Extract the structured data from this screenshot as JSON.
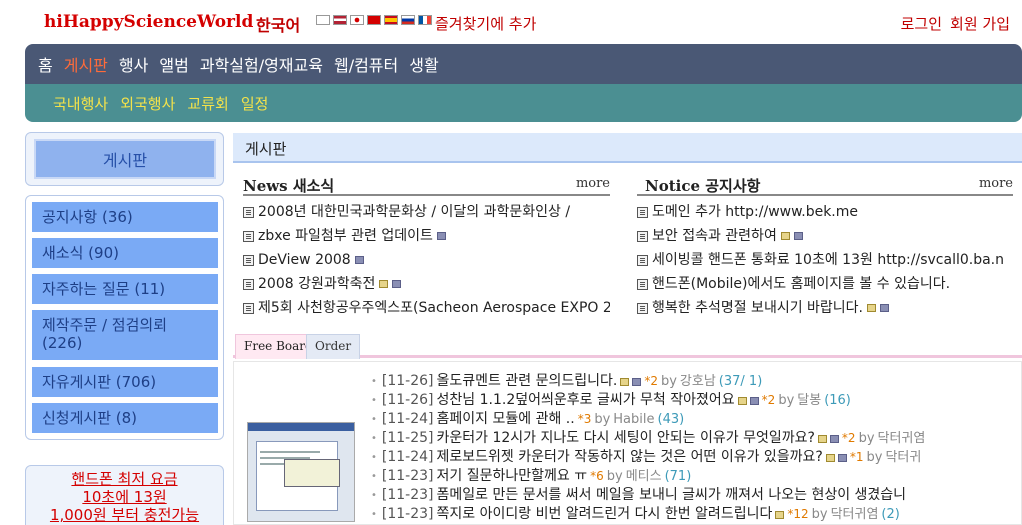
{
  "header": {
    "logo_hi": "hi",
    "logo_mid": "HappyScience",
    "logo_w": "World",
    "language": "한국어",
    "favorite": "즐겨찾기에 추가",
    "login": "로그인",
    "signup": "회원 가입"
  },
  "nav": {
    "main": [
      "홈",
      "게시판",
      "행사",
      "앨범",
      "과학실험/영재교육",
      "웹/컴퓨터",
      "생활"
    ],
    "active_index": 1,
    "sub": [
      "국내행사",
      "외국행사",
      "교류회",
      "일정"
    ]
  },
  "sidebar": {
    "title": "게시판",
    "items": [
      {
        "label": "공지사항 (36)"
      },
      {
        "label": "새소식 (90)"
      },
      {
        "label": "자주하는 질문 (11)"
      },
      {
        "label": "제작주문 / 점검의뢰 (226)"
      },
      {
        "label": "자유게시판 (706)"
      },
      {
        "label": "신청게시판 (8)"
      }
    ],
    "ad": [
      "핸드폰 최저 요금",
      "10초에 13원",
      "1,000원 부터 충전가능"
    ]
  },
  "board": {
    "title": "게시판",
    "news": {
      "title": "News 새소식",
      "more": "more",
      "items": [
        "2008년 대한민국과학문화상 / 이달의 과학문화인상 /",
        "zbxe 파일첨부 관련 업데이트",
        "DeView 2008",
        "2008 강원과학축전",
        "제5회 사천항공우주엑스포(Sacheon Aerospace EXPO 2"
      ]
    },
    "notice": {
      "title": "Notice 공지사항",
      "more": "more",
      "items": [
        "도메인 추가 http://www.bek.me",
        "보안 접속과 관련하여",
        "세이빙콜 핸드폰 통화료 10초에 13원 http://svcall0.ba.n",
        "핸드폰(Mobile)에서도 홈페이지를 볼 수 있습니다.",
        "행복한 추석명절 보내시기 바랍니다."
      ]
    },
    "tabs": [
      "Free Board",
      "Order"
    ],
    "posts": [
      {
        "date": "[11-26]",
        "title": "올도큐멘트 관련 문의드립니다.",
        "comments": "*2",
        "by": "by",
        "author": "강호남",
        "reads": "(37/ 1)"
      },
      {
        "date": "[11-26]",
        "title": "성찬님 1.1.2덮어씌운후로 글씨가 무척 작아졌어요",
        "comments": "*2",
        "by": "by",
        "author": "달봉",
        "reads": "(16)"
      },
      {
        "date": "[11-24]",
        "title": "홈페이지 모듈에 관해 ..",
        "comments": "*3",
        "by": "by",
        "author": "Habile",
        "reads": "(43)"
      },
      {
        "date": "[11-25]",
        "title": "카운터가 12시가 지나도 다시 세팅이 안되는 이유가 무엇일까요?",
        "comments": "*2",
        "by": "by",
        "author": "닥터귀염",
        "reads": ""
      },
      {
        "date": "[11-24]",
        "title": "제로보드위젯 카운터가 작동하지 않는 것은 어떤 이유가 있을까요?",
        "comments": "*1",
        "by": "by",
        "author": "닥터귀",
        "reads": ""
      },
      {
        "date": "[11-23]",
        "title": "저기 질문하나만할께요 ㅠ",
        "comments": "*6",
        "by": "by",
        "author": "메티스",
        "reads": "(71)"
      },
      {
        "date": "[11-23]",
        "title": "폼메일로 만든 문서를 써서 메일을 보내니 글씨가 깨져서 나오는 현상이 생겼습니",
        "comments": "",
        "by": "",
        "author": "",
        "reads": ""
      },
      {
        "date": "[11-23]",
        "title": "쪽지로 아이디랑 비번 알려드린거 다시 한번 알려드립니다",
        "comments": "*12",
        "by": "by",
        "author": "닥터귀염",
        "reads": "(2)"
      }
    ]
  },
  "colors": {
    "brand_red": "#d40000",
    "nav_main": "#4a5875",
    "nav_sub": "#4b8f92",
    "nav_active": "#ff6b3a",
    "sub_text": "#f3e24a",
    "side_item": "#7aaaf5"
  }
}
